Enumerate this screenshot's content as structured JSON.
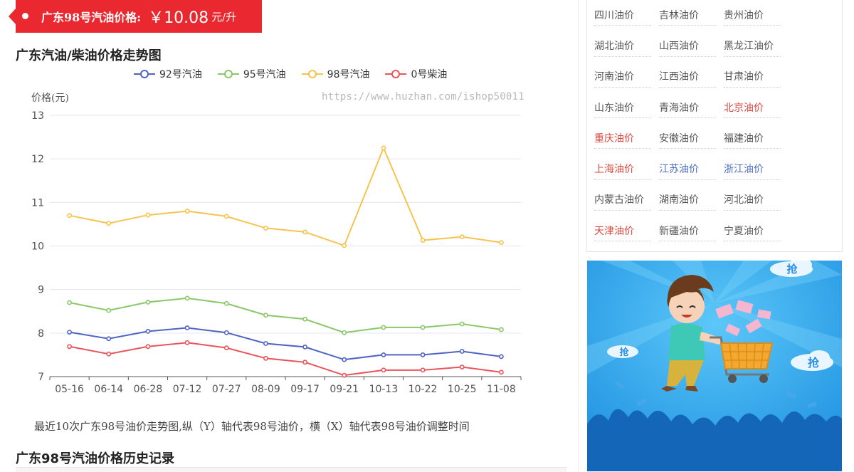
{
  "price_banner": {
    "label": "广东98号汽油价格:",
    "value": "￥10.08",
    "unit": "元/升"
  },
  "chart_section": {
    "title": "广东汽油/柴油价格走势图",
    "watermark": "https://www.huzhan.com/ishop50011",
    "caption": "最近10次广东98号油价走势图,纵（Y）轴代表98号油价，横（X）轴代表98号油价调整时间"
  },
  "history": {
    "title": "广东98号汽油价格历史记录"
  },
  "colors": {
    "banner": "#e9292f",
    "series_92": "#4f63c2",
    "series_95": "#8ac76a",
    "series_98": "#f7c34f",
    "series_0": "#e8555b",
    "link_red": "#d9473e",
    "link_blue": "#4a6fc4"
  },
  "chart_data": {
    "type": "line",
    "ylabel": "价格(元)",
    "xlabel": "",
    "ylim": [
      7,
      13
    ],
    "yticks": [
      7,
      8,
      9,
      10,
      11,
      12,
      13
    ],
    "grid": true,
    "legend_position": "top",
    "categories": [
      "05-16",
      "06-14",
      "06-28",
      "07-12",
      "07-27",
      "08-09",
      "09-17",
      "09-21",
      "10-13",
      "10-22",
      "10-25",
      "11-08"
    ],
    "series": [
      {
        "name": "92号汽油",
        "color": "#4f63c2",
        "values": [
          8.02,
          7.87,
          8.04,
          8.12,
          8.01,
          7.76,
          7.68,
          7.39,
          7.5,
          7.5,
          7.58,
          7.46
        ]
      },
      {
        "name": "95号汽油",
        "color": "#8ac76a",
        "values": [
          8.7,
          8.52,
          8.71,
          8.8,
          8.68,
          8.41,
          8.32,
          8.01,
          8.13,
          8.13,
          8.21,
          8.08
        ]
      },
      {
        "name": "98号汽油",
        "color": "#f7c34f",
        "values": [
          10.7,
          10.52,
          10.71,
          10.8,
          10.68,
          10.41,
          10.32,
          10.01,
          12.25,
          10.13,
          10.21,
          10.08
        ]
      },
      {
        "name": "0号柴油",
        "color": "#e8555b",
        "values": [
          7.69,
          7.52,
          7.69,
          7.78,
          7.66,
          7.42,
          7.33,
          7.03,
          7.15,
          7.15,
          7.22,
          7.1
        ]
      }
    ]
  },
  "sidebar_links": [
    {
      "label": "四川油价",
      "tone": "default"
    },
    {
      "label": "吉林油价",
      "tone": "default"
    },
    {
      "label": "贵州油价",
      "tone": "default"
    },
    {
      "label": "湖北油价",
      "tone": "default"
    },
    {
      "label": "山西油价",
      "tone": "default"
    },
    {
      "label": "黑龙江油价",
      "tone": "default"
    },
    {
      "label": "河南油价",
      "tone": "default"
    },
    {
      "label": "江西油价",
      "tone": "default"
    },
    {
      "label": "甘肃油价",
      "tone": "default"
    },
    {
      "label": "山东油价",
      "tone": "default"
    },
    {
      "label": "青海油价",
      "tone": "default"
    },
    {
      "label": "北京油价",
      "tone": "red"
    },
    {
      "label": "重庆油价",
      "tone": "red"
    },
    {
      "label": "安徽油价",
      "tone": "default"
    },
    {
      "label": "福建油价",
      "tone": "default"
    },
    {
      "label": "上海油价",
      "tone": "red"
    },
    {
      "label": "江苏油价",
      "tone": "blue"
    },
    {
      "label": "浙江油价",
      "tone": "blue"
    },
    {
      "label": "内蒙古油价",
      "tone": "default"
    },
    {
      "label": "湖南油价",
      "tone": "default"
    },
    {
      "label": "河北油价",
      "tone": "default"
    },
    {
      "label": "天津油价",
      "tone": "red"
    },
    {
      "label": "新疆油价",
      "tone": "default"
    },
    {
      "label": "宁夏油价",
      "tone": "default"
    }
  ],
  "ad": {
    "badge_text": "抢"
  }
}
